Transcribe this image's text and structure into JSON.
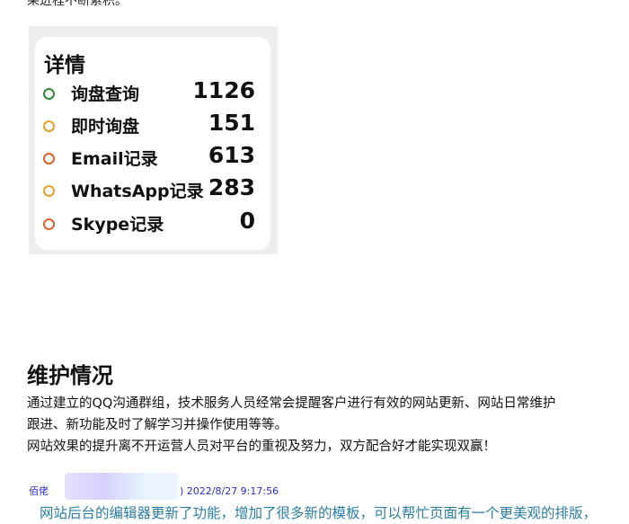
{
  "top_fragment": "果进程不断累积。",
  "details": {
    "title": "详情",
    "rows": [
      {
        "label": "询盘查询",
        "value": "1126",
        "color": "#2e8b2e"
      },
      {
        "label": "即时询盘",
        "value": "151",
        "color": "#e8a12a"
      },
      {
        "label": "Email记录",
        "value": "613",
        "color": "#e0602a"
      },
      {
        "label": "WhatsApp记录",
        "value": "283",
        "color": "#e8a12a"
      },
      {
        "label": "Skype记录",
        "value": "0",
        "color": "#e0602a"
      }
    ]
  },
  "maintenance": {
    "title": "维护情况",
    "lines": [
      "通过建立的QQ沟通群组，技术服务人员经常会提醒客户进行有效的网站更新、网站日常维护",
      "跟进、新功能及时了解学习并操作使用等等。",
      "网站效果的提升离不开运营人员对平台的重视及努力，双方配合好才能实现双赢！"
    ]
  },
  "review": {
    "name_prefix": "佰佬",
    "timestamp": ") 2022/8/27 9:17:56",
    "text": "网站后台的编辑器更新了功能，增加了很多新的模板，可以帮忙页面有一个更美观的排版，"
  }
}
